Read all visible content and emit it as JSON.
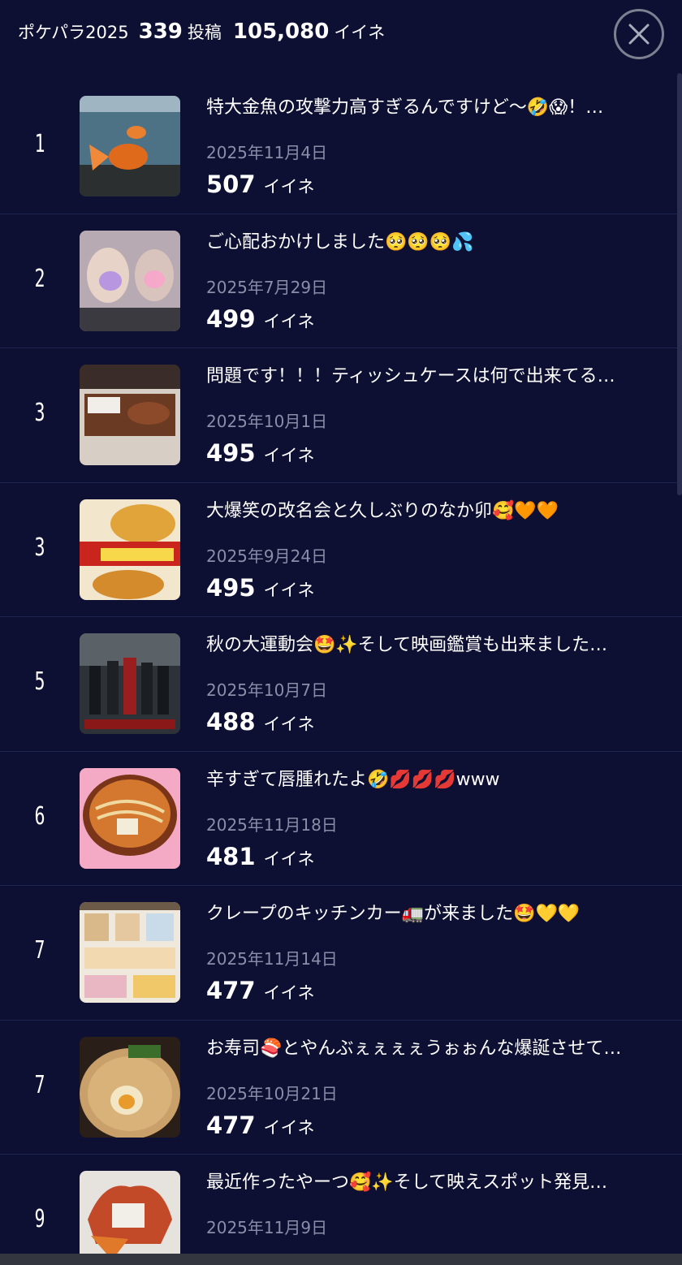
{
  "header": {
    "title": "ポケパラ2025",
    "post_count": "339",
    "post_unit": "投稿",
    "like_total": "105,080",
    "like_unit": "イイネ"
  },
  "close_icon": "close-icon",
  "posts": [
    {
      "rank": "1",
      "title": "特大金魚の攻撃力高すぎるんですけど〜🤣😱！…",
      "date": "2025年11月4日",
      "likes": "507",
      "likes_unit": "イイネ",
      "thumb": "goldfish"
    },
    {
      "rank": "2",
      "title": "ご心配おかけしました🥺🥺🥺💦",
      "date": "2025年7月29日",
      "likes": "499",
      "likes_unit": "イイネ",
      "thumb": "selfie"
    },
    {
      "rank": "3",
      "title": "問題です！！！ティッシュケースは何で出来てる…",
      "date": "2025年10月1日",
      "likes": "495",
      "likes_unit": "イイネ",
      "thumb": "chocolate"
    },
    {
      "rank": "3",
      "title": "大爆笑の改名会と久しぶりのなか卯🥰🧡🧡",
      "date": "2025年9月24日",
      "likes": "495",
      "likes_unit": "イイネ",
      "thumb": "udon"
    },
    {
      "rank": "5",
      "title": "秋の大運動会🤩✨そして映画鑑賞も出来ました…",
      "date": "2025年10月7日",
      "likes": "488",
      "likes_unit": "イイネ",
      "thumb": "movie"
    },
    {
      "rank": "6",
      "title": "辛すぎて唇腫れたよ🤣💋💋💋www",
      "date": "2025年11月18日",
      "likes": "481",
      "likes_unit": "イイネ",
      "thumb": "ramen"
    },
    {
      "rank": "7",
      "title": "クレープのキッチンカー🚛が来ました🤩💛💛",
      "date": "2025年11月14日",
      "likes": "477",
      "likes_unit": "イイネ",
      "thumb": "crepe"
    },
    {
      "rank": "7",
      "title": "お寿司🍣とやんぶぇぇぇぇうぉぉんな爆誕させて…",
      "date": "2025年10月21日",
      "likes": "477",
      "likes_unit": "イイネ",
      "thumb": "tonkotsu"
    },
    {
      "rank": "9",
      "title": "最近作ったやーつ🥰✨そして映えスポット発見…",
      "date": "2025年11月9日",
      "likes": "",
      "likes_unit": "",
      "thumb": "craft"
    }
  ]
}
